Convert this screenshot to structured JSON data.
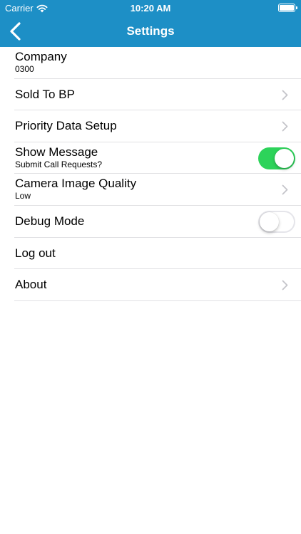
{
  "status_bar": {
    "carrier": "Carrier",
    "time": "10:20 AM"
  },
  "nav": {
    "title": "Settings",
    "back_icon": "chevron-left-icon"
  },
  "colors": {
    "header": "#1d8fc6",
    "toggle_on": "#2dd35a",
    "separator": "#e0e0e3",
    "chevron": "#c4c4c9"
  },
  "settings": [
    {
      "title": "Company",
      "subtitle": "0300"
    },
    {
      "title": "Sold To BP"
    },
    {
      "title": "Priority Data Setup"
    },
    {
      "title": "Show Message",
      "subtitle": "Submit Call Requests?",
      "toggle": true
    },
    {
      "title": "Camera Image Quality",
      "subtitle": "Low"
    },
    {
      "title": "Debug Mode",
      "toggle": false
    },
    {
      "title": "Log out"
    },
    {
      "title": "About"
    }
  ]
}
